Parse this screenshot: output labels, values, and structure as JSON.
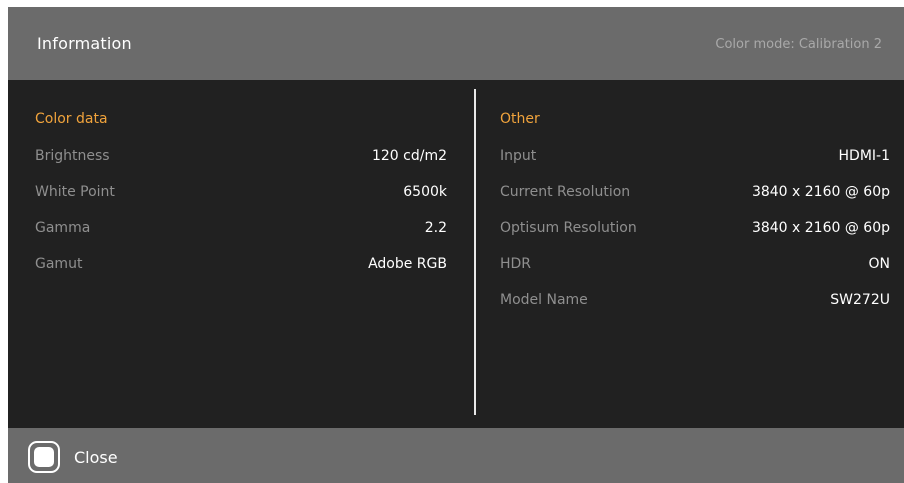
{
  "header": {
    "title": "Information",
    "color_mode": "Color mode: Calibration 2"
  },
  "color_data": {
    "title": "Color data",
    "rows": [
      {
        "label": "Brightness",
        "value": "120 cd/m2"
      },
      {
        "label": "White Point",
        "value": "6500k"
      },
      {
        "label": "Gamma",
        "value": "2.2"
      },
      {
        "label": "Gamut",
        "value": "Adobe RGB"
      }
    ]
  },
  "other": {
    "title": "Other",
    "rows": [
      {
        "label": "Input",
        "value": "HDMI-1"
      },
      {
        "label": "Current Resolution",
        "value": "3840 x 2160 @ 60p"
      },
      {
        "label": "Optisum Resolution",
        "value": "3840 x 2160 @ 60p"
      },
      {
        "label": "HDR",
        "value": "ON"
      },
      {
        "label": "Model Name",
        "value": "SW272U"
      }
    ]
  },
  "footer": {
    "close_label": "Close",
    "close_icon": "rounded-square-button-icon"
  },
  "colors": {
    "header_bg": "#6b6b6b",
    "body_bg": "#212121",
    "accent": "#f0a33c",
    "label": "#8f8f8f",
    "value": "#ffffff"
  }
}
